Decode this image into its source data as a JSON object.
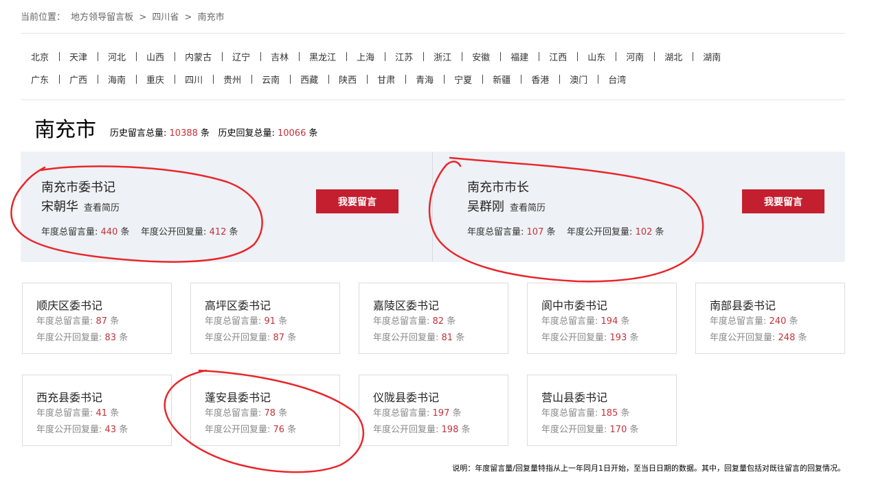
{
  "breadcrumb": {
    "prefix": "当前位置：",
    "items": [
      "地方领导留言板",
      "四川省",
      "南充市"
    ],
    "separator": ">"
  },
  "regions": [
    [
      "北京",
      "天津",
      "河北",
      "山西",
      "内蒙古",
      "辽宁",
      "吉林",
      "黑龙江",
      "上海",
      "江苏",
      "浙江",
      "安徽",
      "福建",
      "江西",
      "山东",
      "河南",
      "湖北",
      "湖南"
    ],
    [
      "广东",
      "广西",
      "海南",
      "重庆",
      "四川",
      "贵州",
      "云南",
      "西藏",
      "陕西",
      "甘肃",
      "青海",
      "宁夏",
      "新疆",
      "香港",
      "澳门",
      "台湾"
    ]
  ],
  "city": {
    "title": "南充市",
    "history_total_label": "历史留言总量:",
    "history_total_value": "10388",
    "history_reply_label": "历史回复总量:",
    "history_reply_value": "10066",
    "unit": "条"
  },
  "leaders": [
    {
      "title": "南充市委书记",
      "name": "宋朝华",
      "resume_label": "查看简历",
      "total_label": "年度总留言量:",
      "total_value": "440",
      "reply_label": "年度公开回复量:",
      "reply_value": "412",
      "unit": "条",
      "button_label": "我要留言"
    },
    {
      "title": "南充市市长",
      "name": "吴群刚",
      "resume_label": "查看简历",
      "total_label": "年度总留言量:",
      "total_value": "107",
      "reply_label": "年度公开回复量:",
      "reply_value": "102",
      "unit": "条",
      "button_label": "我要留言"
    }
  ],
  "cards_labels": {
    "total": "年度总留言量:",
    "reply": "年度公开回复量:",
    "unit": "条"
  },
  "cards": [
    {
      "title": "顺庆区委书记",
      "total": "87",
      "reply": "83"
    },
    {
      "title": "高坪区委书记",
      "total": "91",
      "reply": "87"
    },
    {
      "title": "嘉陵区委书记",
      "total": "82",
      "reply": "81"
    },
    {
      "title": "阆中市委书记",
      "total": "194",
      "reply": "193"
    },
    {
      "title": "南部县委书记",
      "total": "240",
      "reply": "248"
    },
    {
      "title": "西充县委书记",
      "total": "41",
      "reply": "43"
    },
    {
      "title": "蓬安县委书记",
      "total": "78",
      "reply": "76"
    },
    {
      "title": "仪陇县委书记",
      "total": "197",
      "reply": "198"
    },
    {
      "title": "营山县委书记",
      "total": "185",
      "reply": "170"
    }
  ],
  "footnote": "说明：年度留言量/回复量特指从上一年同月1日开始，至当日日期的数据。其中，回复量包括对既往留言的回复情况。",
  "colors": {
    "accent_red": "#c41f2f",
    "number_red": "#c4323a",
    "band_bg": "#eef1f5",
    "annotation_red": "#e8262b"
  }
}
